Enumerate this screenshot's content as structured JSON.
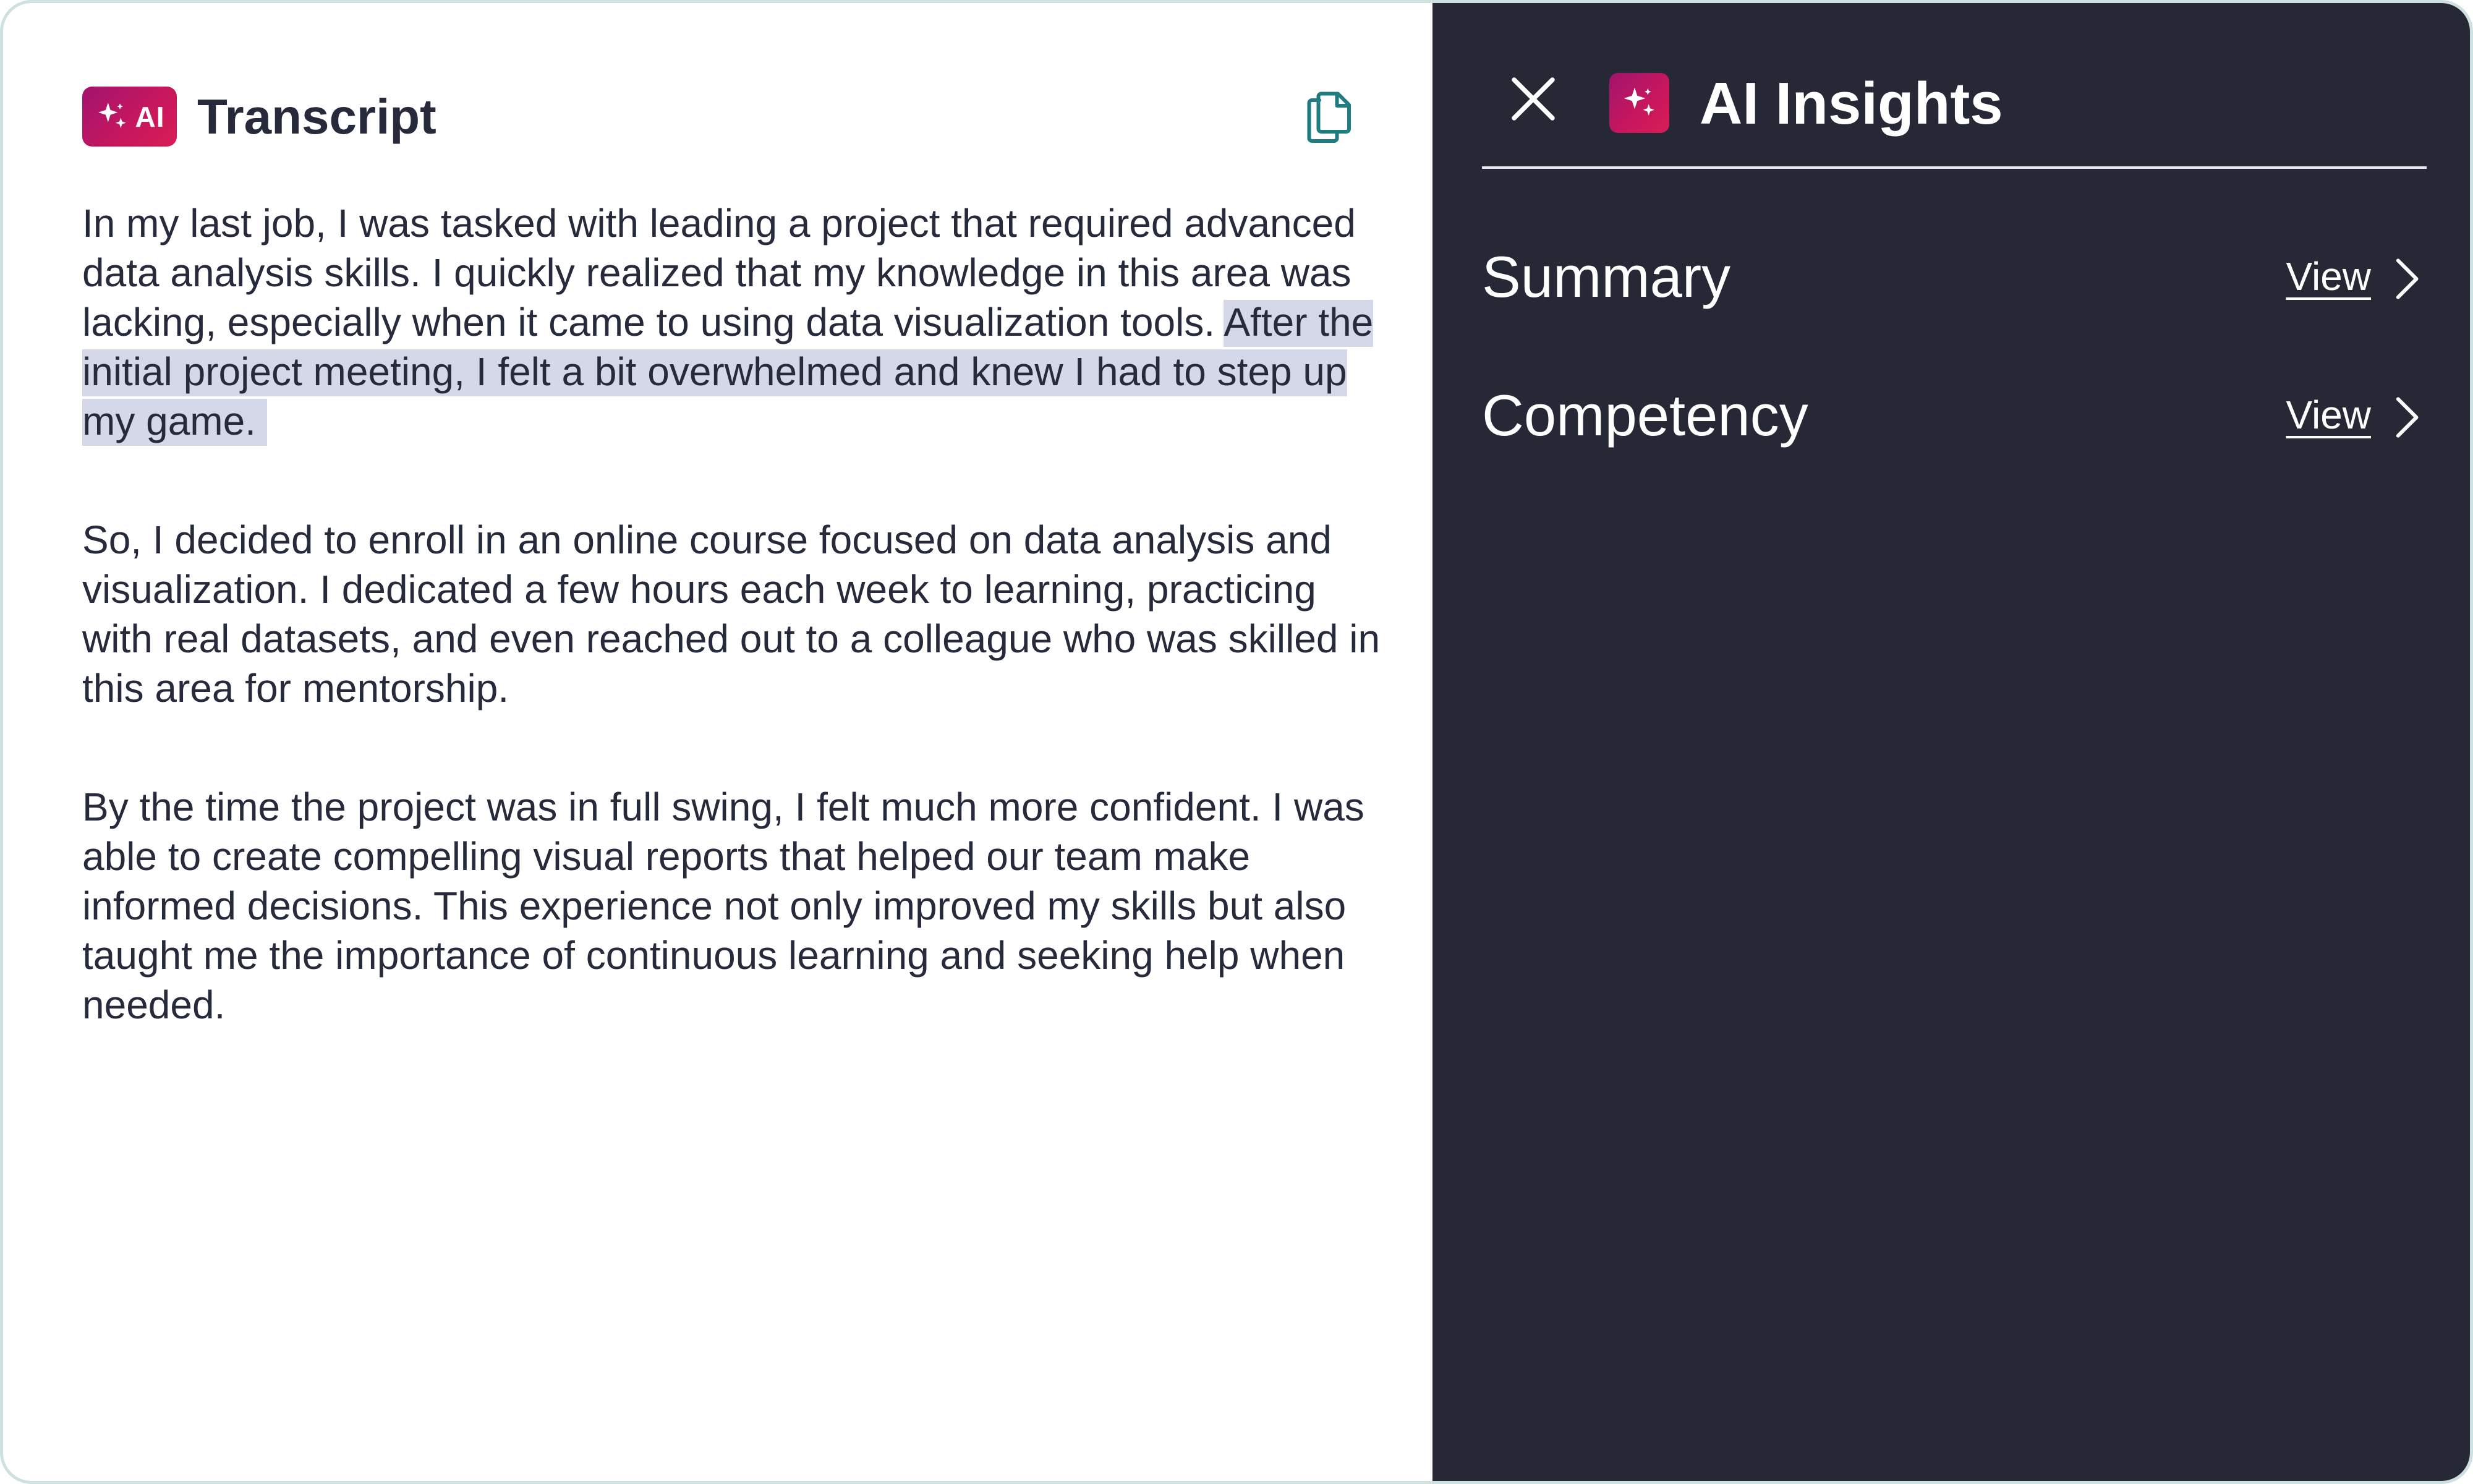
{
  "transcript": {
    "badge_text": "AI",
    "title": "Transcript",
    "paragraphs": [
      {
        "before": "In my last job, I was tasked with leading a project that required advanced data analysis skills. I quickly realized that my knowledge in this area was lacking, especially when it came to using data visualization tools. ",
        "highlight": "After the initial project meeting, I felt a bit overwhelmed and knew I had to step up my game."
      },
      {
        "text": "So, I decided to enroll in an online course focused on data analysis and visualization. I dedicated a few hours each week to learning, practicing with real datasets, and even reached out to a colleague who was skilled in this area for mentorship."
      },
      {
        "text": "By the time the project was in full swing, I felt much more confident. I was able to create compelling visual reports that helped our team make informed decisions. This experience not only improved my skills but also taught me the importance of continuous learning and seeking help when needed."
      }
    ],
    "icons": {
      "badge": "sparkle-icon",
      "copy": "copy-icon"
    }
  },
  "insights": {
    "title": "AI Insights",
    "icons": {
      "close": "close-icon",
      "badge": "sparkle-icon",
      "chevron": "chevron-right-icon"
    },
    "items": [
      {
        "label": "Summary",
        "action": "View"
      },
      {
        "label": "Competency",
        "action": "View"
      }
    ]
  },
  "colors": {
    "panel_dark": "#262835",
    "text_dark": "#262a3a",
    "highlight": "#d4d8e8",
    "brand_gradient_start": "#a1146e",
    "brand_gradient_end": "#d81d54",
    "copy_icon": "#1f7d82"
  }
}
